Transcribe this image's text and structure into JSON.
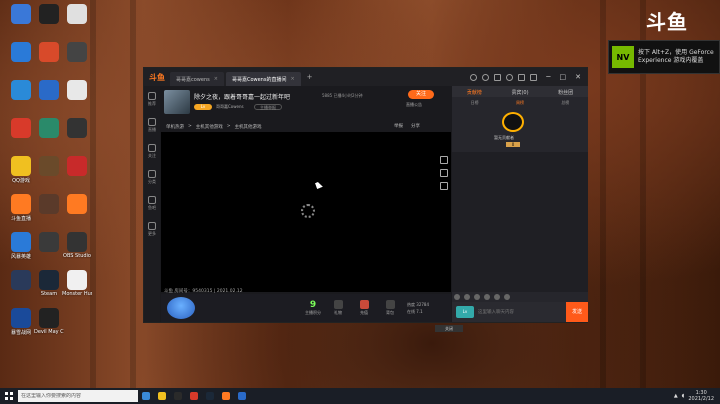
{
  "desktop": {
    "icons": [
      {
        "label": "",
        "color": "#3a78d8"
      },
      {
        "label": "",
        "color": "#222222"
      },
      {
        "label": "",
        "color": "#e0e0e0"
      },
      {
        "label": "",
        "color": "#2a7ad8"
      },
      {
        "label": "",
        "color": "#d84a2a"
      },
      {
        "label": "",
        "color": "#444444"
      },
      {
        "label": "",
        "color": "#2a8ad8"
      },
      {
        "label": "",
        "color": "#2a6ac8"
      },
      {
        "label": "",
        "color": "#e8e8e8"
      },
      {
        "label": "",
        "color": "#d83a2a"
      },
      {
        "label": "",
        "color": "#2a8a6a"
      },
      {
        "label": "",
        "color": "#333333"
      },
      {
        "label": "QQ游戏",
        "color": "#f0c020"
      },
      {
        "label": "",
        "color": "#6a4a2a"
      },
      {
        "label": "",
        "color": "#c82a2a"
      },
      {
        "label": "斗鱼直播",
        "color": "#ff7a22"
      },
      {
        "label": "",
        "color": "#5a3a2a"
      },
      {
        "label": "",
        "color": "#ff7a22"
      },
      {
        "label": "风暴英雄",
        "color": "#2a7ad8"
      },
      {
        "label": "",
        "color": "#3a3a3a"
      },
      {
        "label": "OBS Studio",
        "color": "#333333"
      },
      {
        "label": "",
        "color": "#2a3a5a"
      },
      {
        "label": "Steam",
        "color": "#1b2838"
      },
      {
        "label": "Monster Hunter",
        "color": "#f0f0f0"
      },
      {
        "label": "暴雪战网",
        "color": "#1a4a9a"
      },
      {
        "label": "Devil May Cry 5",
        "color": "#222222"
      }
    ]
  },
  "brand_logo": "斗鱼",
  "toast": {
    "line1": "按下 Alt+Z，使用 GeForce",
    "line2": "Experience 游戏内覆盖",
    "brand": "NV"
  },
  "window": {
    "app_logo": "斗鱼",
    "tabs": [
      {
        "label": "哥哥嘉cowens"
      },
      {
        "label": "哥哥嘉Cowens的直播间"
      }
    ],
    "tab_add": "+",
    "win_controls": {
      "min": "─",
      "max": "□",
      "close": "✕"
    }
  },
  "leftnav": {
    "items": [
      {
        "label": "推荐"
      },
      {
        "label": "直播"
      },
      {
        "label": "关注"
      },
      {
        "label": "分类"
      },
      {
        "label": "鱼吧"
      },
      {
        "label": "更多"
      }
    ]
  },
  "stream": {
    "title": "除夕之夜，跟着哥哥嘉一起过新年吧",
    "stats": "5885  已播4小时2分钟",
    "level": "Lv",
    "streamer": "哥哥嘉Cowens",
    "report": "主播举报",
    "follow": "关注",
    "follow_count": "直播公告",
    "breadcrumb": [
      "单机热游",
      ">",
      "主机其他游戏",
      ">",
      "主机其他游戏"
    ],
    "video_actions": [
      "举报",
      "分享"
    ],
    "room_info": "斗鱼 房间号：9540315 | 2021.02.12",
    "close_label": "关闭",
    "score_value": "9",
    "score_label": "主播积分",
    "bottom_icons": [
      {
        "label": "礼物"
      },
      {
        "label": "充值"
      },
      {
        "label": "背包"
      }
    ],
    "viewer_line1": "热度 32784",
    "viewer_line2": "在线 7.1"
  },
  "chat": {
    "tabs": [
      {
        "label": "贡献榜",
        "active": true
      },
      {
        "label": "贵宾(0)",
        "active": false
      },
      {
        "label": "粉丝团",
        "active": false
      }
    ],
    "subtabs": [
      {
        "label": "日榜",
        "active": false
      },
      {
        "label": "周榜",
        "active": true
      },
      {
        "label": "总榜",
        "active": false
      }
    ],
    "rank_label": "暂无贡献者",
    "rank_badge": "0",
    "user_level": "Lv",
    "input_placeholder": "这里输入聊天内容",
    "send": "发送"
  },
  "taskbar": {
    "search_placeholder": "在这里输入你要搜索的内容",
    "apps": [
      {
        "color": "#3a8ad8"
      },
      {
        "color": "#f0c020"
      },
      {
        "color": "#2a2a2a"
      },
      {
        "color": "#d83a2a"
      },
      {
        "color": "#1b2838"
      },
      {
        "color": "#ff7a22"
      },
      {
        "color": "#2a6ac8"
      }
    ],
    "time": "1:30",
    "date": "2021/2/12"
  }
}
